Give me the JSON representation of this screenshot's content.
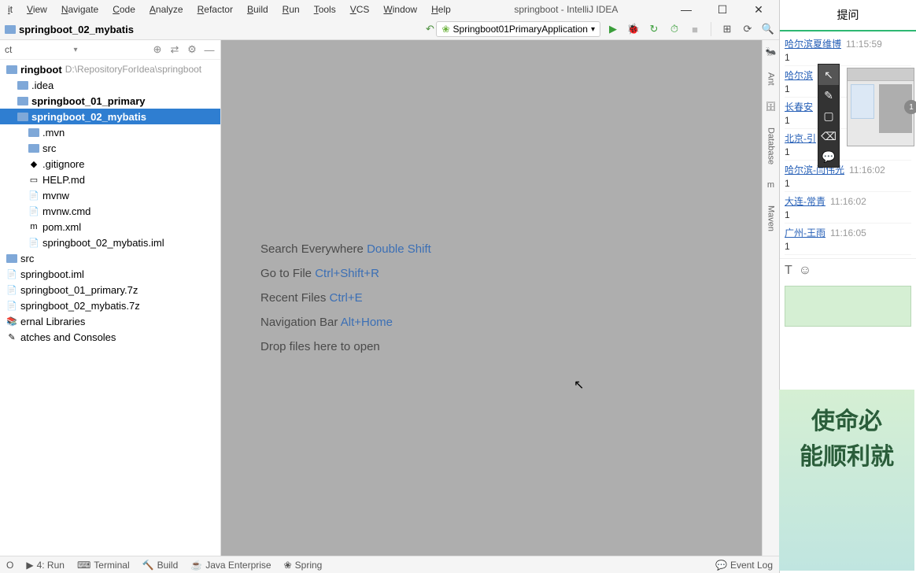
{
  "menubar": [
    "it",
    "View",
    "Navigate",
    "Code",
    "Analyze",
    "Refactor",
    "Build",
    "Run",
    "Tools",
    "VCS",
    "Window",
    "Help"
  ],
  "title": "springboot - IntelliJ IDEA",
  "breadcrumb": "springboot_02_mybatis",
  "run_config": "Springboot01PrimaryApplication",
  "project_header": "ct",
  "tree": [
    {
      "indent": 0,
      "icon": "folder",
      "label": "ringboot",
      "path": "D:\\RepositoryForIdea\\springboot",
      "sel": false,
      "bold": true
    },
    {
      "indent": 1,
      "icon": "folder",
      "label": ".idea",
      "sel": false
    },
    {
      "indent": 1,
      "icon": "folder",
      "label": "springboot_01_primary",
      "sel": false,
      "bold": true
    },
    {
      "indent": 1,
      "icon": "folder",
      "label": "springboot_02_mybatis",
      "sel": true,
      "bold": true
    },
    {
      "indent": 2,
      "icon": "folder",
      "label": ".mvn",
      "sel": false
    },
    {
      "indent": 2,
      "icon": "folder",
      "label": "src",
      "sel": false
    },
    {
      "indent": 2,
      "icon": "git",
      "label": ".gitignore",
      "sel": false
    },
    {
      "indent": 2,
      "icon": "md",
      "label": "HELP.md",
      "sel": false
    },
    {
      "indent": 2,
      "icon": "file",
      "label": "mvnw",
      "sel": false
    },
    {
      "indent": 2,
      "icon": "file",
      "label": "mvnw.cmd",
      "sel": false
    },
    {
      "indent": 2,
      "icon": "maven",
      "label": "pom.xml",
      "sel": false
    },
    {
      "indent": 2,
      "icon": "file",
      "label": "springboot_02_mybatis.iml",
      "sel": false
    },
    {
      "indent": 1,
      "icon": "folder",
      "label": "src",
      "sel": false,
      "pad": -1
    },
    {
      "indent": 1,
      "icon": "file",
      "label": "springboot.iml",
      "sel": false,
      "pad": -1
    },
    {
      "indent": 1,
      "icon": "file",
      "label": "springboot_01_primary.7z",
      "sel": false,
      "pad": -1
    },
    {
      "indent": 1,
      "icon": "file",
      "label": "springboot_02_mybatis.7z",
      "sel": false,
      "pad": -1
    },
    {
      "indent": 0,
      "icon": "lib",
      "label": "ernal Libraries",
      "sel": false,
      "pad": -1
    },
    {
      "indent": 0,
      "icon": "scratch",
      "label": "atches and Consoles",
      "sel": false,
      "pad": -1
    }
  ],
  "hints": [
    {
      "label": "Search Everywhere",
      "shortcut": "Double Shift"
    },
    {
      "label": "Go to File",
      "shortcut": "Ctrl+Shift+R"
    },
    {
      "label": "Recent Files",
      "shortcut": "Ctrl+E"
    },
    {
      "label": "Navigation Bar",
      "shortcut": "Alt+Home"
    },
    {
      "label": "Drop files here to open",
      "shortcut": ""
    }
  ],
  "right_stripe": [
    "Ant",
    "Database",
    "Maven"
  ],
  "statusbar": {
    "left": [
      "O",
      "4: Run",
      "Terminal",
      "Build",
      "Java Enterprise",
      "Spring"
    ],
    "right": "Event Log"
  },
  "chat": {
    "header": "提问",
    "messages": [
      {
        "user": "哈尔滨夏维博",
        "time": "11:15:59",
        "body": "1"
      },
      {
        "user": "哈尔滨",
        "time": "",
        "body": "1"
      },
      {
        "user": "长春安",
        "time": "",
        "body": "1"
      },
      {
        "user": "北京-引",
        "time": "",
        "body": "1"
      },
      {
        "user": "哈尔滨-闫伟光",
        "time": "11:16:02",
        "body": "1"
      },
      {
        "user": "大连-常青",
        "time": "11:16:02",
        "body": "1"
      },
      {
        "user": "广州-王雨",
        "time": "11:16:05",
        "body": "1"
      }
    ],
    "banner": [
      "使命必",
      "能顺利就"
    ]
  }
}
